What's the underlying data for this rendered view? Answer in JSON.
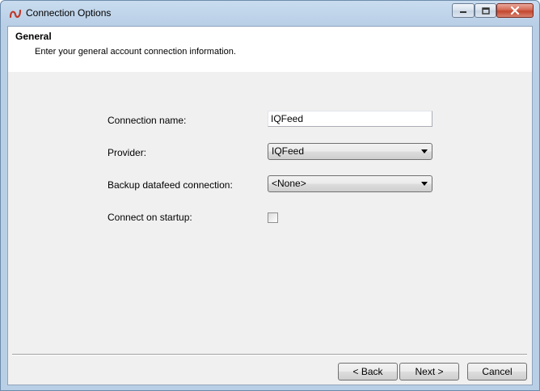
{
  "window": {
    "title": "Connection Options",
    "accent_color": "#b9cfe6"
  },
  "header": {
    "title": "General",
    "subtitle": "Enter your general account connection information."
  },
  "form": {
    "connection_name_label": "Connection name:",
    "connection_name_value": "IQFeed",
    "provider_label": "Provider:",
    "provider_value": "IQFeed",
    "backup_label": "Backup datafeed connection:",
    "backup_value": "<None>",
    "startup_label": "Connect on startup:",
    "startup_checked": false
  },
  "buttons": {
    "back": "< Back",
    "next": "Next >",
    "cancel": "Cancel"
  },
  "icons": {
    "app": "app-logo-icon",
    "minimize": "minimize-icon",
    "maximize": "maximize-icon",
    "close": "close-icon",
    "dropdown": "chevron-down-icon"
  }
}
